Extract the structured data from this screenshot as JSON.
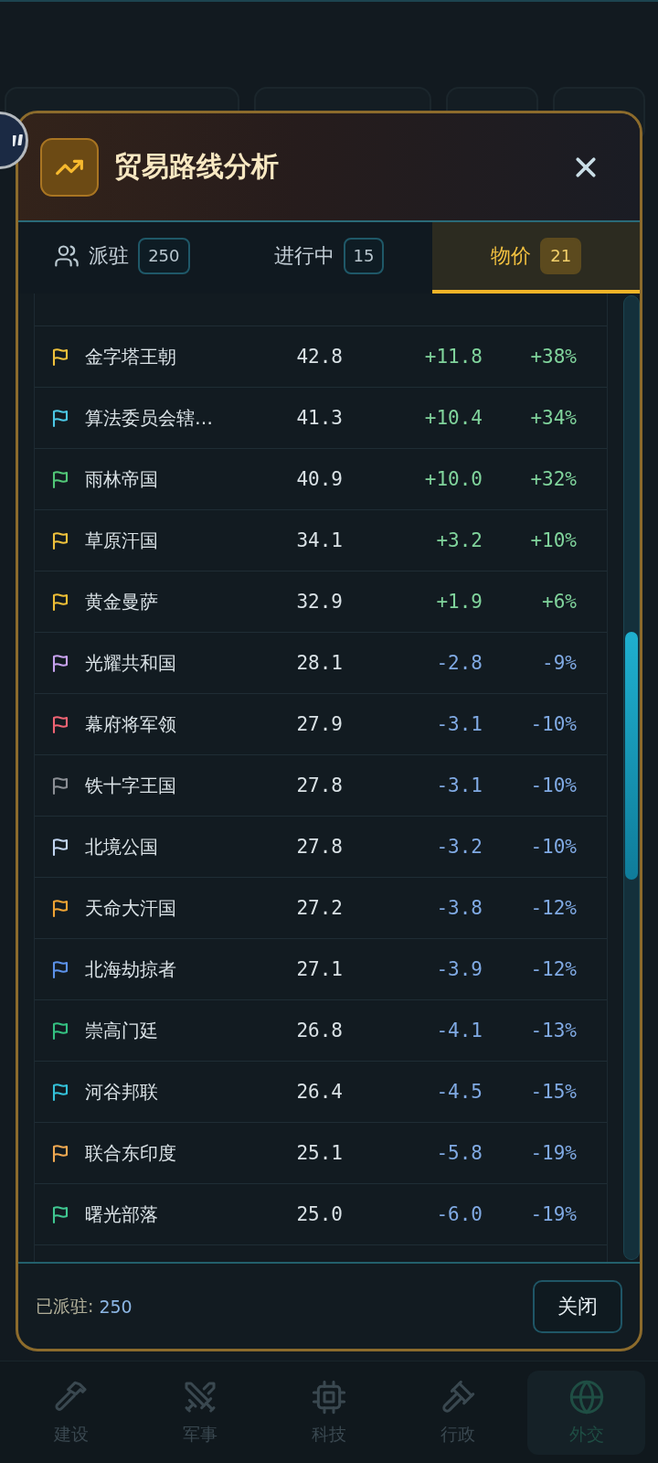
{
  "background": {
    "nav": [
      {
        "label": "建设",
        "selected": false
      },
      {
        "label": "军事",
        "selected": false
      },
      {
        "label": "科技",
        "selected": false
      },
      {
        "label": "行政",
        "selected": false
      },
      {
        "label": "外交",
        "selected": true
      }
    ]
  },
  "dialog": {
    "title": "贸易路线分析",
    "tabs": [
      {
        "label": "派驻",
        "count": "250",
        "kind": "icon",
        "selected": false
      },
      {
        "label": "进行中",
        "count": "15",
        "kind": "plain",
        "selected": false
      },
      {
        "label": "物价",
        "count": "21",
        "kind": "plain",
        "selected": true
      }
    ],
    "rows": [
      {
        "name": "金字塔王朝",
        "value": "42.8",
        "change": "+11.8",
        "percent": "+38%",
        "kind": "gain",
        "color": "#f0c23c"
      },
      {
        "name": "算法委员会辖…",
        "value": "41.3",
        "change": "+10.4",
        "percent": "+34%",
        "kind": "gain",
        "color": "#4cc8e6"
      },
      {
        "name": "雨林帝国",
        "value": "40.9",
        "change": "+10.0",
        "percent": "+32%",
        "kind": "gain",
        "color": "#52c878"
      },
      {
        "name": "草原汗国",
        "value": "34.1",
        "change": "+3.2",
        "percent": "+10%",
        "kind": "gain",
        "color": "#f0c23c"
      },
      {
        "name": "黄金曼萨",
        "value": "32.9",
        "change": "+1.9",
        "percent": "+6%",
        "kind": "gain",
        "color": "#f0bf36"
      },
      {
        "name": "光耀共和国",
        "value": "28.1",
        "change": "-2.8",
        "percent": "-9%",
        "kind": "loss",
        "color": "#c8a2f0"
      },
      {
        "name": "幕府将军领",
        "value": "27.9",
        "change": "-3.1",
        "percent": "-10%",
        "kind": "loss",
        "color": "#f06474"
      },
      {
        "name": "铁十字王国",
        "value": "27.8",
        "change": "-3.1",
        "percent": "-10%",
        "kind": "loss",
        "color": "#8c9096"
      },
      {
        "name": "北境公国",
        "value": "27.8",
        "change": "-3.2",
        "percent": "-10%",
        "kind": "loss",
        "color": "#c2d6f2"
      },
      {
        "name": "天命大汗国",
        "value": "27.2",
        "change": "-3.8",
        "percent": "-12%",
        "kind": "loss",
        "color": "#f0a434"
      },
      {
        "name": "北海劫掠者",
        "value": "27.1",
        "change": "-3.9",
        "percent": "-12%",
        "kind": "loss",
        "color": "#5c92ea"
      },
      {
        "name": "崇高门廷",
        "value": "26.8",
        "change": "-4.1",
        "percent": "-13%",
        "kind": "loss",
        "color": "#34c282"
      },
      {
        "name": "河谷邦联",
        "value": "26.4",
        "change": "-4.5",
        "percent": "-15%",
        "kind": "loss",
        "color": "#34c2da"
      },
      {
        "name": "联合东印度",
        "value": "25.1",
        "change": "-5.8",
        "percent": "-19%",
        "kind": "loss",
        "color": "#f2aa52"
      },
      {
        "name": "曙光部落",
        "value": "25.0",
        "change": "-6.0",
        "percent": "-19%",
        "kind": "loss",
        "color": "#40c892"
      }
    ],
    "footer": {
      "label": "已派驻:",
      "value": "250",
      "close_button": "关闭"
    }
  }
}
